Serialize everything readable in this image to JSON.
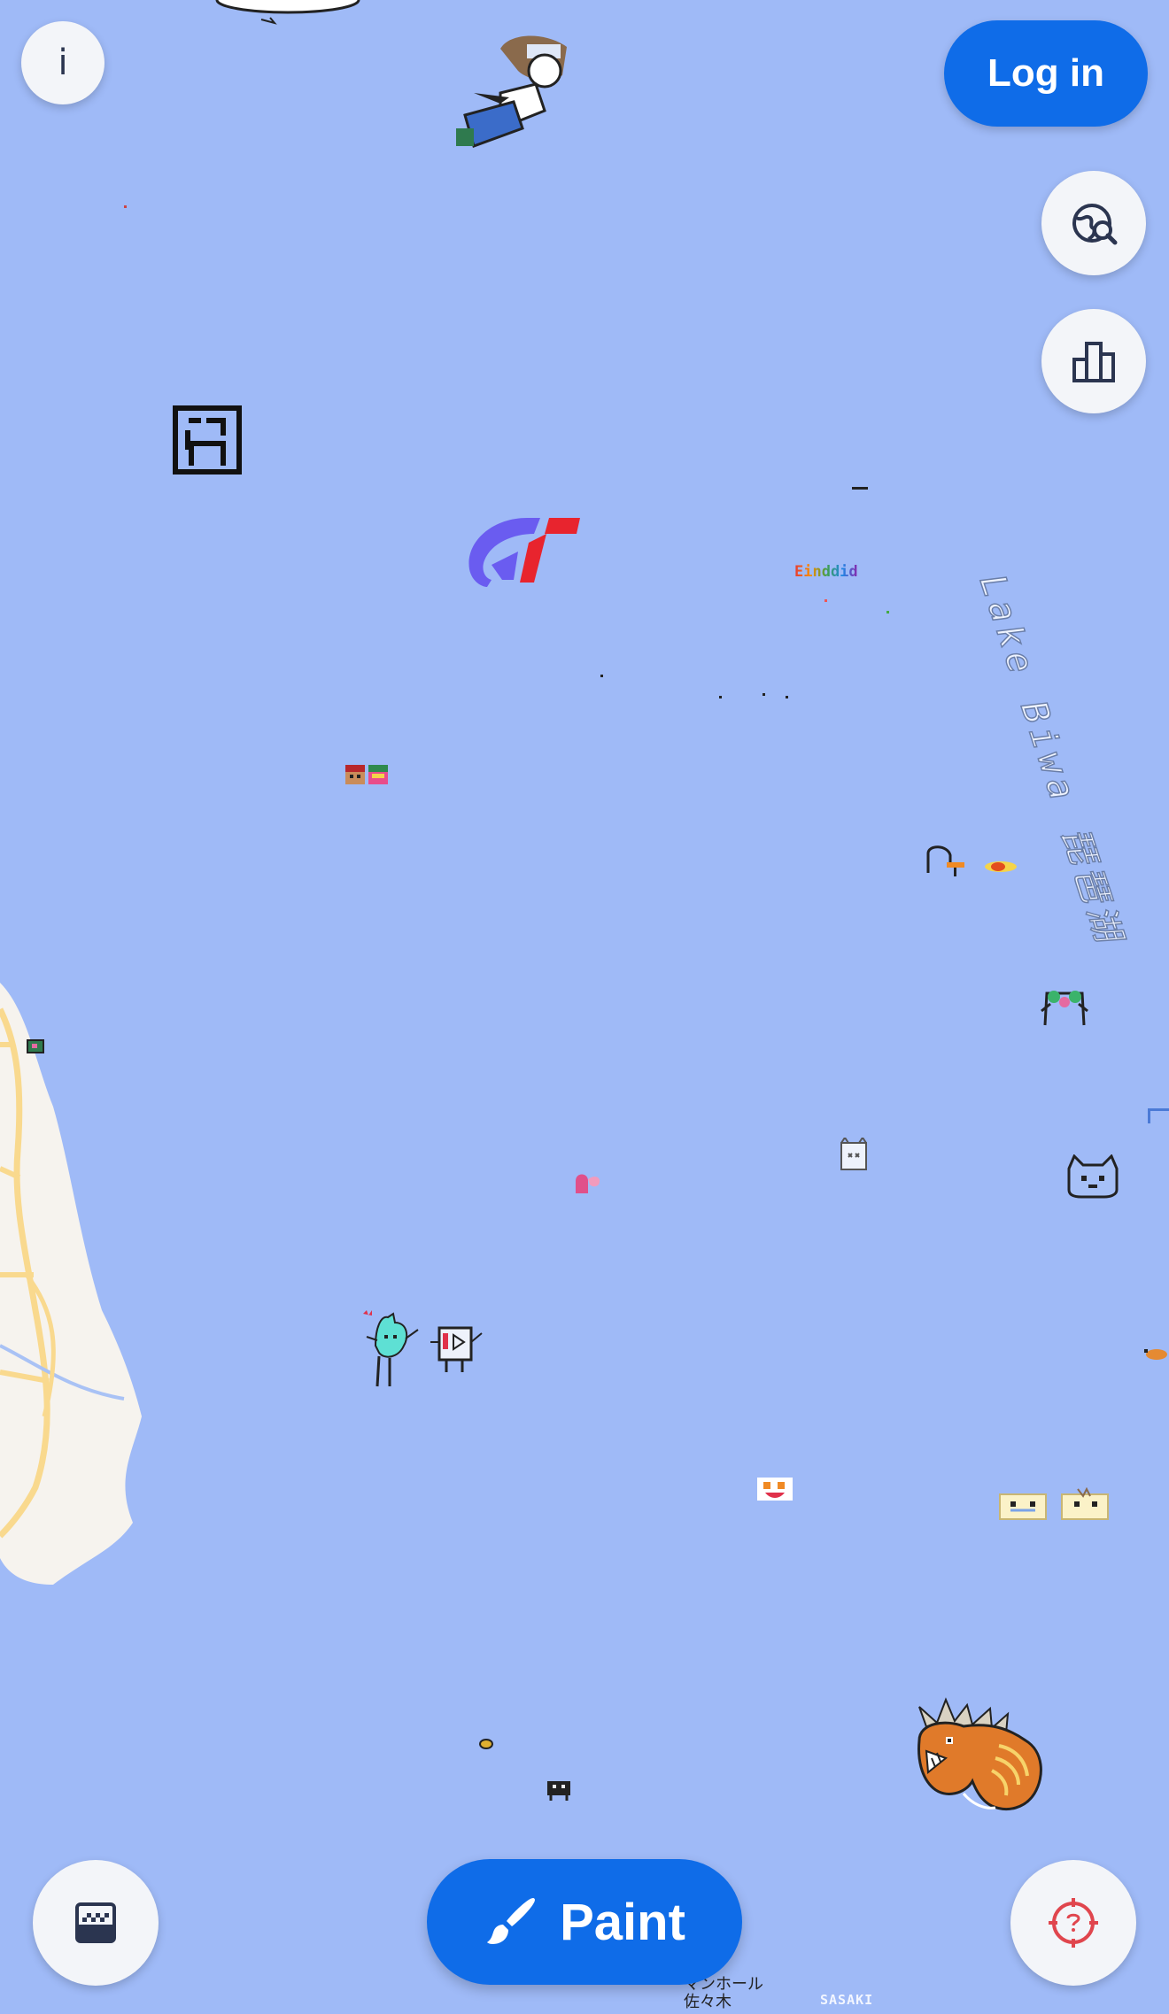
{
  "map": {
    "lake_label": "Lake Biwa 琵琶湖",
    "pixel_texts": {
      "rainbow_tag": "Einddid",
      "bottom_jp": "マンホール 佐々木",
      "bottom_tag": "SASAKI"
    }
  },
  "header": {
    "info_label": "i",
    "login_label": "Log in"
  },
  "side_tools": [
    {
      "name": "explore",
      "icon": "globe-search-icon"
    },
    {
      "name": "leaderboard",
      "icon": "leaderboard-icon"
    }
  ],
  "footer": {
    "paint_label": "Paint",
    "paint_icon": "paintbrush-icon",
    "left_icon": "canvas-layer-icon",
    "right_icon": "crosshair-icon"
  },
  "colors": {
    "water": "#9fbaf7",
    "land": "#f6f3ee",
    "road": "#f9d98e",
    "accent": "#0f6ce8",
    "crosshair": "#e0464e"
  }
}
